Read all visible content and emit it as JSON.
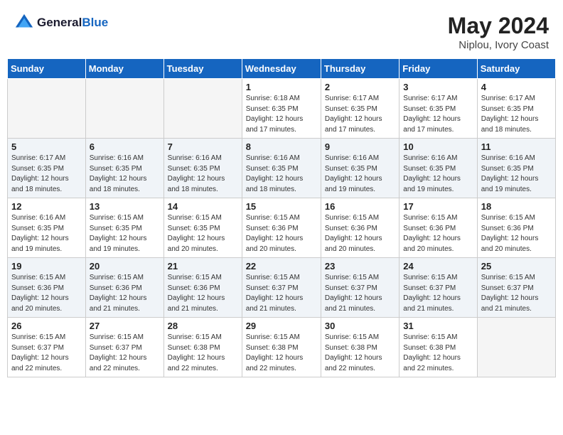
{
  "header": {
    "logo_line1": "General",
    "logo_line2": "Blue",
    "month": "May 2024",
    "location": "Niplou, Ivory Coast"
  },
  "weekdays": [
    "Sunday",
    "Monday",
    "Tuesday",
    "Wednesday",
    "Thursday",
    "Friday",
    "Saturday"
  ],
  "weeks": [
    {
      "shaded": false,
      "days": [
        {
          "num": "",
          "info": ""
        },
        {
          "num": "",
          "info": ""
        },
        {
          "num": "",
          "info": ""
        },
        {
          "num": "1",
          "info": "Sunrise: 6:18 AM\nSunset: 6:35 PM\nDaylight: 12 hours\nand 17 minutes."
        },
        {
          "num": "2",
          "info": "Sunrise: 6:17 AM\nSunset: 6:35 PM\nDaylight: 12 hours\nand 17 minutes."
        },
        {
          "num": "3",
          "info": "Sunrise: 6:17 AM\nSunset: 6:35 PM\nDaylight: 12 hours\nand 17 minutes."
        },
        {
          "num": "4",
          "info": "Sunrise: 6:17 AM\nSunset: 6:35 PM\nDaylight: 12 hours\nand 18 minutes."
        }
      ]
    },
    {
      "shaded": true,
      "days": [
        {
          "num": "5",
          "info": "Sunrise: 6:17 AM\nSunset: 6:35 PM\nDaylight: 12 hours\nand 18 minutes."
        },
        {
          "num": "6",
          "info": "Sunrise: 6:16 AM\nSunset: 6:35 PM\nDaylight: 12 hours\nand 18 minutes."
        },
        {
          "num": "7",
          "info": "Sunrise: 6:16 AM\nSunset: 6:35 PM\nDaylight: 12 hours\nand 18 minutes."
        },
        {
          "num": "8",
          "info": "Sunrise: 6:16 AM\nSunset: 6:35 PM\nDaylight: 12 hours\nand 18 minutes."
        },
        {
          "num": "9",
          "info": "Sunrise: 6:16 AM\nSunset: 6:35 PM\nDaylight: 12 hours\nand 19 minutes."
        },
        {
          "num": "10",
          "info": "Sunrise: 6:16 AM\nSunset: 6:35 PM\nDaylight: 12 hours\nand 19 minutes."
        },
        {
          "num": "11",
          "info": "Sunrise: 6:16 AM\nSunset: 6:35 PM\nDaylight: 12 hours\nand 19 minutes."
        }
      ]
    },
    {
      "shaded": false,
      "days": [
        {
          "num": "12",
          "info": "Sunrise: 6:16 AM\nSunset: 6:35 PM\nDaylight: 12 hours\nand 19 minutes."
        },
        {
          "num": "13",
          "info": "Sunrise: 6:15 AM\nSunset: 6:35 PM\nDaylight: 12 hours\nand 19 minutes."
        },
        {
          "num": "14",
          "info": "Sunrise: 6:15 AM\nSunset: 6:35 PM\nDaylight: 12 hours\nand 20 minutes."
        },
        {
          "num": "15",
          "info": "Sunrise: 6:15 AM\nSunset: 6:36 PM\nDaylight: 12 hours\nand 20 minutes."
        },
        {
          "num": "16",
          "info": "Sunrise: 6:15 AM\nSunset: 6:36 PM\nDaylight: 12 hours\nand 20 minutes."
        },
        {
          "num": "17",
          "info": "Sunrise: 6:15 AM\nSunset: 6:36 PM\nDaylight: 12 hours\nand 20 minutes."
        },
        {
          "num": "18",
          "info": "Sunrise: 6:15 AM\nSunset: 6:36 PM\nDaylight: 12 hours\nand 20 minutes."
        }
      ]
    },
    {
      "shaded": true,
      "days": [
        {
          "num": "19",
          "info": "Sunrise: 6:15 AM\nSunset: 6:36 PM\nDaylight: 12 hours\nand 20 minutes."
        },
        {
          "num": "20",
          "info": "Sunrise: 6:15 AM\nSunset: 6:36 PM\nDaylight: 12 hours\nand 21 minutes."
        },
        {
          "num": "21",
          "info": "Sunrise: 6:15 AM\nSunset: 6:36 PM\nDaylight: 12 hours\nand 21 minutes."
        },
        {
          "num": "22",
          "info": "Sunrise: 6:15 AM\nSunset: 6:37 PM\nDaylight: 12 hours\nand 21 minutes."
        },
        {
          "num": "23",
          "info": "Sunrise: 6:15 AM\nSunset: 6:37 PM\nDaylight: 12 hours\nand 21 minutes."
        },
        {
          "num": "24",
          "info": "Sunrise: 6:15 AM\nSunset: 6:37 PM\nDaylight: 12 hours\nand 21 minutes."
        },
        {
          "num": "25",
          "info": "Sunrise: 6:15 AM\nSunset: 6:37 PM\nDaylight: 12 hours\nand 21 minutes."
        }
      ]
    },
    {
      "shaded": false,
      "days": [
        {
          "num": "26",
          "info": "Sunrise: 6:15 AM\nSunset: 6:37 PM\nDaylight: 12 hours\nand 22 minutes."
        },
        {
          "num": "27",
          "info": "Sunrise: 6:15 AM\nSunset: 6:37 PM\nDaylight: 12 hours\nand 22 minutes."
        },
        {
          "num": "28",
          "info": "Sunrise: 6:15 AM\nSunset: 6:38 PM\nDaylight: 12 hours\nand 22 minutes."
        },
        {
          "num": "29",
          "info": "Sunrise: 6:15 AM\nSunset: 6:38 PM\nDaylight: 12 hours\nand 22 minutes."
        },
        {
          "num": "30",
          "info": "Sunrise: 6:15 AM\nSunset: 6:38 PM\nDaylight: 12 hours\nand 22 minutes."
        },
        {
          "num": "31",
          "info": "Sunrise: 6:15 AM\nSunset: 6:38 PM\nDaylight: 12 hours\nand 22 minutes."
        },
        {
          "num": "",
          "info": ""
        }
      ]
    }
  ]
}
